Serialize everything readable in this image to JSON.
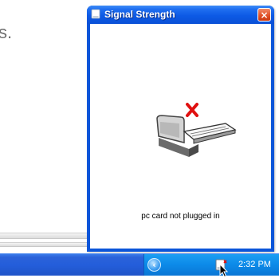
{
  "background": {
    "text_fragment": "s."
  },
  "window": {
    "title": "Signal Strength",
    "close_label": "×",
    "status_message": "pc card not plugged in",
    "error_mark_color": "#e01010",
    "titlebar_color": "#0a5ad6"
  },
  "taskbar": {
    "chevron_label": "‹",
    "clock": "2:32 PM",
    "tray_icons": [
      "show-hidden-icons-chevron-icon",
      "pc-card-signal-icon"
    ]
  }
}
